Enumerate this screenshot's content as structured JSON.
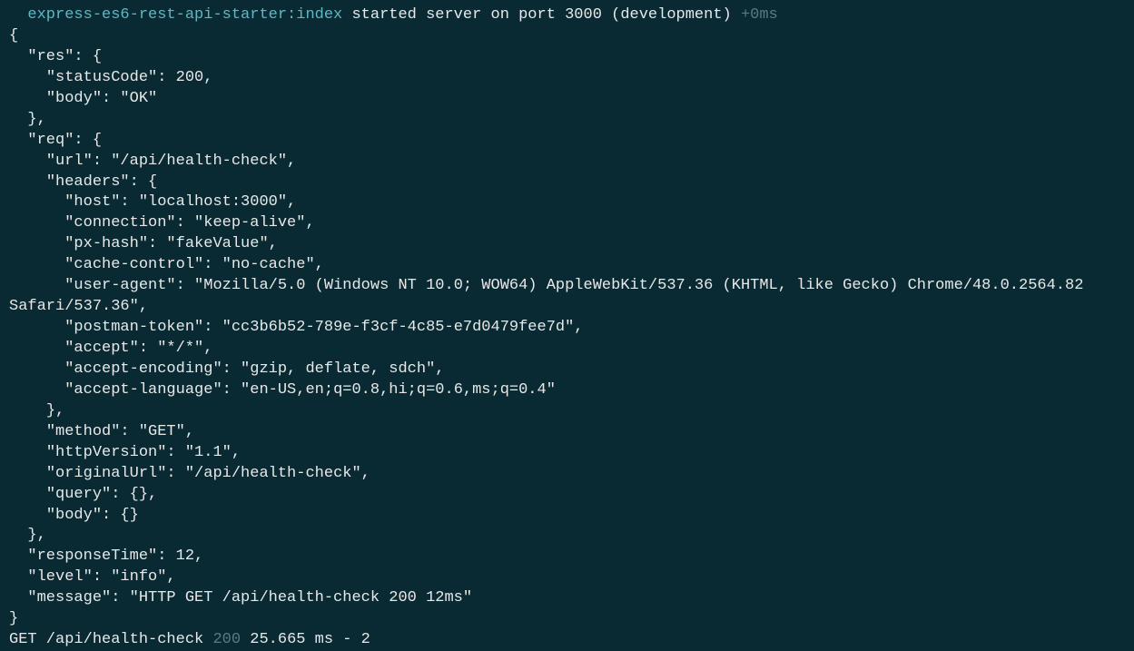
{
  "startup": {
    "namespace": "express-es6-rest-api-starter:index",
    "message": "started server on port 3000 (development)",
    "timing": "+0ms"
  },
  "jsonBlock": "{\n  \"res\": {\n    \"statusCode\": 200,\n    \"body\": \"OK\"\n  },\n  \"req\": {\n    \"url\": \"/api/health-check\",\n    \"headers\": {\n      \"host\": \"localhost:3000\",\n      \"connection\": \"keep-alive\",\n      \"px-hash\": \"fakeValue\",\n      \"cache-control\": \"no-cache\",\n      \"user-agent\": \"Mozilla/5.0 (Windows NT 10.0; WOW64) AppleWebKit/537.36 (KHTML, like Gecko) Chrome/48.0.2564.82 Safari/537.36\",\n      \"postman-token\": \"cc3b6b52-789e-f3cf-4c85-e7d0479fee7d\",\n      \"accept\": \"*/*\",\n      \"accept-encoding\": \"gzip, deflate, sdch\",\n      \"accept-language\": \"en-US,en;q=0.8,hi;q=0.6,ms;q=0.4\"\n    },\n    \"method\": \"GET\",\n    \"httpVersion\": \"1.1\",\n    \"originalUrl\": \"/api/health-check\",\n    \"query\": {},\n    \"body\": {}\n  },\n  \"responseTime\": 12,\n  \"level\": \"info\",\n  \"message\": \"HTTP GET /api/health-check 200 12ms\"\n}",
  "morgan": {
    "prefix": "GET /api/health-check",
    "status": "200",
    "suffix": "25.665 ms - 2"
  }
}
